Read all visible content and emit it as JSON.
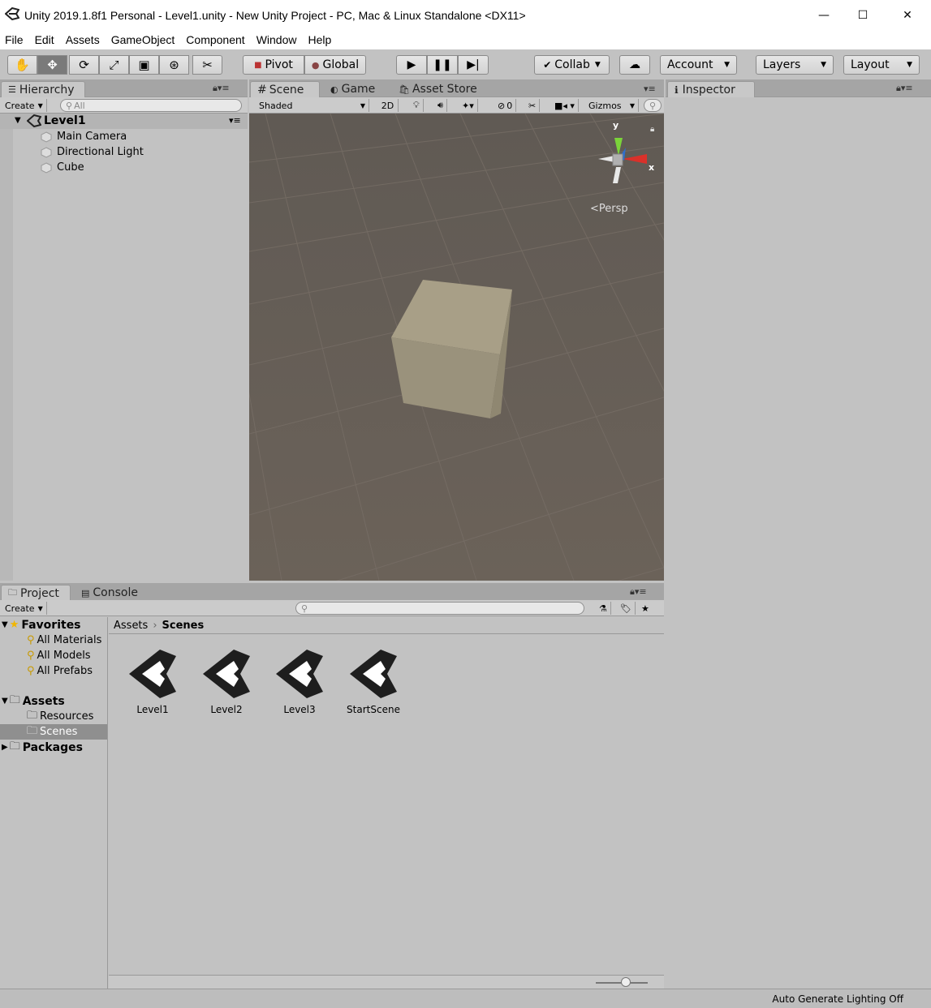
{
  "window": {
    "title": "Unity 2019.1.8f1 Personal - Level1.unity - New Unity Project - PC, Mac & Linux Standalone <DX11>",
    "minimize": "—",
    "maximize": "☐",
    "close": "✕"
  },
  "menu": [
    "File",
    "Edit",
    "Assets",
    "GameObject",
    "Component",
    "Window",
    "Help"
  ],
  "toolbar": {
    "pivot": "Pivot",
    "global": "Global",
    "collab": "Collab",
    "account": "Account",
    "layers": "Layers",
    "layout": "Layout"
  },
  "hierarchy": {
    "tab": "Hierarchy",
    "create": "Create",
    "search_placeholder": "All",
    "scene_name": "Level1",
    "items": [
      "Main Camera",
      "Directional Light",
      "Cube"
    ]
  },
  "scene": {
    "tabs": [
      "Scene",
      "Game",
      "Asset Store"
    ],
    "shading": "Shaded",
    "mode2d": "2D",
    "hidden_count": "0",
    "gizmos": "Gizmos",
    "persp": "Persp",
    "axis_y": "y",
    "axis_x": "x"
  },
  "inspector": {
    "tab": "Inspector"
  },
  "project": {
    "tabs": [
      "Project",
      "Console"
    ],
    "create": "Create",
    "breadcrumb_root": "Assets",
    "breadcrumb_current": "Scenes",
    "favorites_label": "Favorites",
    "favorites": [
      "All Materials",
      "All Models",
      "All Prefabs"
    ],
    "assets_label": "Assets",
    "asset_folders": [
      "Resources",
      "Scenes"
    ],
    "packages_label": "Packages",
    "files": [
      "Level1",
      "Level2",
      "Level3",
      "StartScene"
    ]
  },
  "status": {
    "text": "Auto Generate Lighting Off"
  },
  "colors": {
    "scene_bg": "#6b6259",
    "cube": "#a89f87",
    "selection": "#8f8f8f"
  }
}
